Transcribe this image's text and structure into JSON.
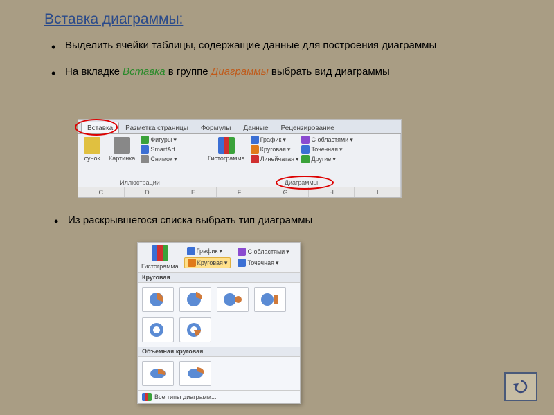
{
  "title": "Вставка диаграммы:",
  "bullets": {
    "b1": "Выделить ячейки таблицы, содержащие данные для построения диаграммы",
    "b2_pre": "На вкладке ",
    "b2_kw1": "Вставка",
    "b2_mid": " в группе ",
    "b2_kw2": "Диаграммы",
    "b2_post": " выбрать вид диаграммы",
    "b3": "Из раскрывшегося списка выбрать тип диаграммы"
  },
  "ribbon1": {
    "tabs": [
      "Вставка",
      "Разметка страницы",
      "Формулы",
      "Данные",
      "Рецензирование"
    ],
    "group_illustrations": {
      "btn_picture": "сунок",
      "btn_clipart": "Картинка",
      "btn_shapes": "Фигуры",
      "btn_smartart": "SmartArt",
      "btn_screenshot": "Снимок",
      "label": "Иллюстрации"
    },
    "group_charts": {
      "btn_histogram": "Гистограмма",
      "btn_line": "График",
      "btn_pie": "Круговая",
      "btn_bar": "Линейчатая",
      "btn_area": "С областями",
      "btn_scatter": "Точечная",
      "btn_other": "Другие",
      "label": "Диаграммы"
    },
    "columns": [
      "C",
      "D",
      "E",
      "F",
      "G",
      "H",
      "I"
    ]
  },
  "ribbon2": {
    "btn_histogram": "Гистограмма",
    "btn_line": "График",
    "btn_pie": "Круговая",
    "btn_area": "С областями",
    "btn_scatter": "Точечная",
    "section1": "Круговая",
    "section2": "Объемная круговая",
    "footer": "Все типы диаграмм..."
  },
  "back": "back"
}
